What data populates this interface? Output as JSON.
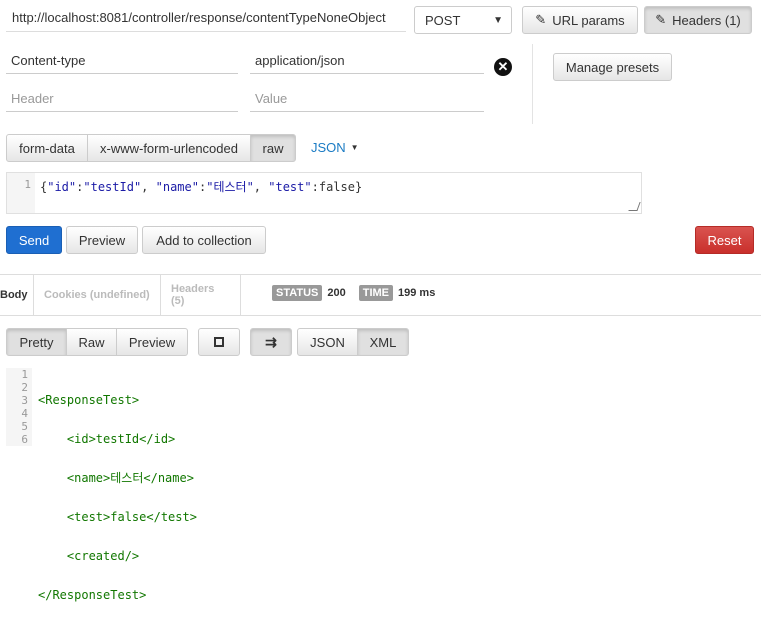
{
  "request": {
    "url": "http://localhost:8081/controller/response/contentTypeNoneObject",
    "method": "POST",
    "url_params_label": "URL params",
    "headers_label": "Headers (1)"
  },
  "headers": {
    "rows": [
      {
        "key": "Content-type",
        "value": "application/json"
      }
    ],
    "key_placeholder": "Header",
    "value_placeholder": "Value",
    "manage_presets": "Manage presets"
  },
  "body_tabs": {
    "form_data": "form-data",
    "urlencoded": "x-www-form-urlencoded",
    "raw": "raw",
    "format": "JSON"
  },
  "body_editor": {
    "line_number": "1",
    "code_open": "{",
    "k1": "\"id\"",
    "v1": "\"testId\"",
    "k2": "\"name\"",
    "v2": "\"테스터\"",
    "k3": "\"test\"",
    "v3": "false",
    "code_close": "}"
  },
  "actions": {
    "send": "Send",
    "preview": "Preview",
    "add_to_collection": "Add to collection",
    "reset": "Reset"
  },
  "response_tabs": {
    "body": "Body",
    "cookies": "Cookies (undefined)",
    "headers": "Headers (5)",
    "status_label": "STATUS",
    "status_value": "200",
    "time_label": "TIME",
    "time_value": "199 ms"
  },
  "view_tabs": {
    "pretty": "Pretty",
    "raw": "Raw",
    "preview": "Preview",
    "json": "JSON",
    "xml": "XML"
  },
  "response_body": {
    "line_numbers": [
      "1",
      "2",
      "3",
      "4",
      "5",
      "6"
    ],
    "lines": [
      "<ResponseTest>",
      "    <id>testId</id>",
      "    <name>테스터</name>",
      "    <test>false</test>",
      "    <created/>",
      "</ResponseTest>"
    ]
  },
  "colors": {
    "send_bg": "#1f6fd1",
    "reset_bg": "#c9302c",
    "link": "#1a7bc4",
    "xml_tag": "#117700"
  }
}
